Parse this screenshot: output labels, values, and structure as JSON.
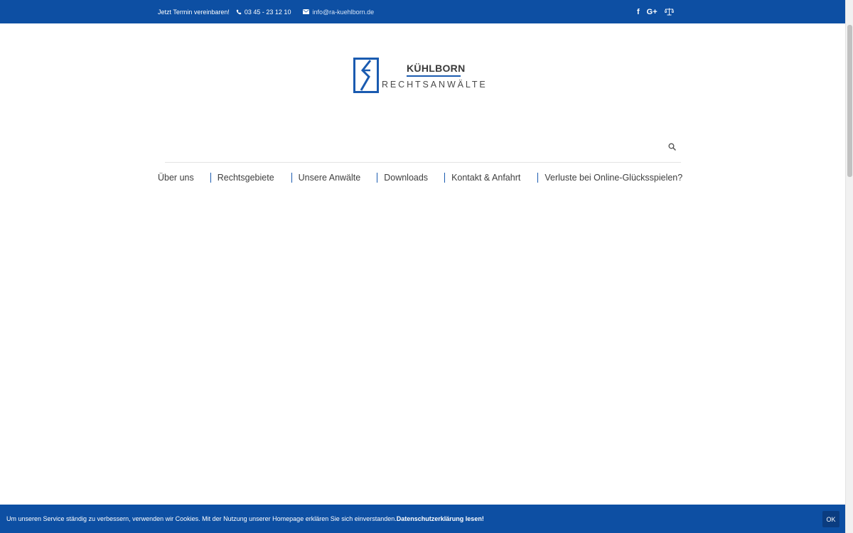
{
  "topbar": {
    "cta": "Jetzt Termin vereinbaren!",
    "phone": "03 45 - 23 12 10",
    "email": "info@ra-kuehlborn.de",
    "social": {
      "facebook": "f",
      "google_plus": "G+"
    },
    "icons": [
      "phone-icon",
      "envelope-icon",
      "facebook-icon",
      "google-plus-icon",
      "balance-scale-icon"
    ]
  },
  "logo": {
    "name": "KÜHLBORN",
    "tagline": "RECHTSANWÄLTE",
    "brand_color": "#1a5bb0"
  },
  "nav": {
    "items": [
      "Über uns",
      "Rechtsgebiete",
      "Unsere Anwälte",
      "Downloads",
      "Kontakt & Anfahrt",
      "Verluste bei Online-Glücksspielen?"
    ]
  },
  "cookie": {
    "text": "Um unseren Service ständig zu verbessern, verwenden wir Cookies. Mit der Nutzung unserer Homepage erklären Sie sich einverstanden.",
    "link": "Datenschutzerklärung lesen!",
    "ok": "OK"
  },
  "colors": {
    "primary": "#0d4fa3",
    "accent": "#1a5bb0",
    "text": "#444444"
  }
}
